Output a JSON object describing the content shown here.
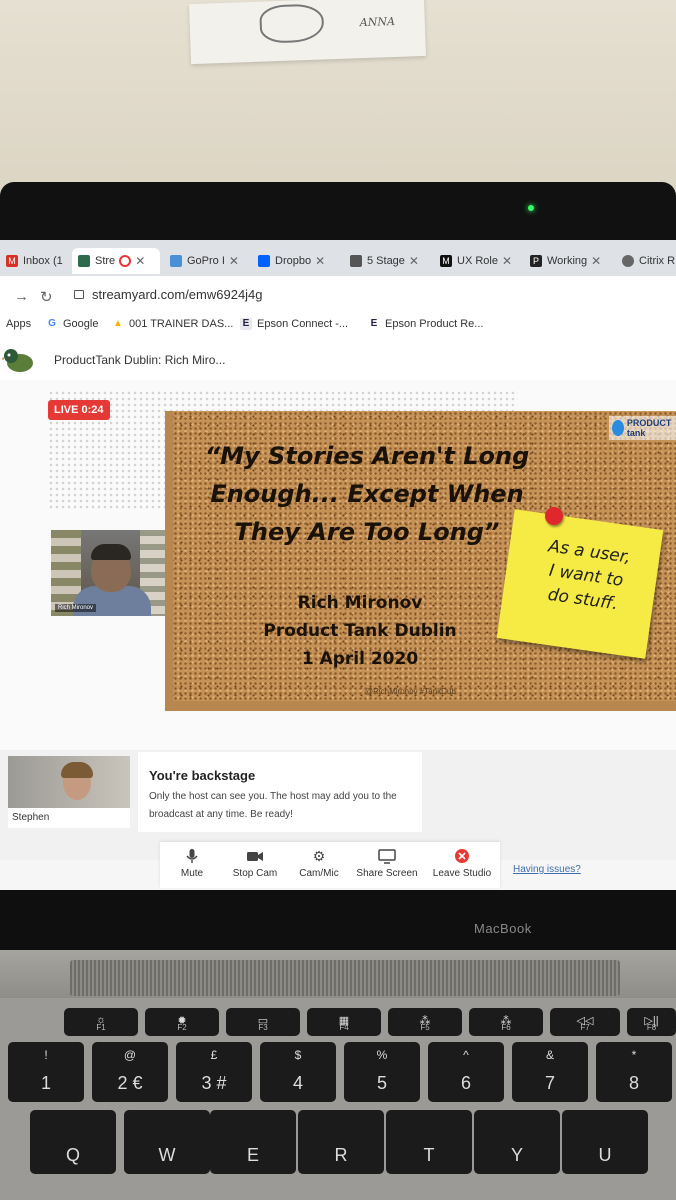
{
  "wall_note": {
    "text": "ANNA"
  },
  "browser": {
    "tabs": [
      {
        "label": "Inbox (1",
        "icon": "mail-icon",
        "color": "#d93025",
        "close": "✕"
      },
      {
        "label": "Stre",
        "icon": "streamyard-icon",
        "color": "#2d6b4e",
        "close": "✕",
        "recording": true
      },
      {
        "label": "GoPro I",
        "icon": "gopro-icon",
        "color": "#4a90d9",
        "close": "✕"
      },
      {
        "label": "Dropbo",
        "icon": "dropbox-icon",
        "color": "#0061fe",
        "close": "✕"
      },
      {
        "label": "5 Stage",
        "icon": "tree-icon",
        "color": "#555555",
        "close": "✕"
      },
      {
        "label": "UX Role",
        "icon": "medium-icon",
        "color": "#111111",
        "close": "✕"
      },
      {
        "label": "Working",
        "icon": "p-icon",
        "color": "#222222",
        "close": "✕"
      },
      {
        "label": "Citrix R",
        "icon": "citrix-icon",
        "color": "#666666",
        "close": ""
      }
    ],
    "url": "streamyard.com/emw6924j4g",
    "bookmarks": [
      {
        "label": "Apps",
        "icon": "apps-icon"
      },
      {
        "label": "Google",
        "icon": "google-icon"
      },
      {
        "label": "001 TRAINER DAS...",
        "icon": "drive-icon"
      },
      {
        "label": "Epson Connect -...",
        "icon": "epson-icon"
      },
      {
        "label": "Epson Product Re...",
        "icon": "epson-icon"
      }
    ]
  },
  "app": {
    "stream_title": "ProductTank Dublin: Rich Miro...",
    "live_badge": "LIVE 0:24",
    "speaker_name": "Rich Mironov",
    "slide": {
      "title_lines": [
        "“My Stories Aren't Long",
        "Enough... Except When",
        "They Are Too Long”"
      ],
      "author_lines": [
        "Rich Mironov",
        "Product Tank Dublin",
        "1 April 2020"
      ],
      "postit_lines": [
        "As a user,",
        "I want to",
        "do stuff."
      ],
      "brand": "PRODUCT tank",
      "credit": "@RichMironov #TankDub"
    },
    "backstage": {
      "self_name": "Stephen",
      "title": "You're backstage",
      "text": "Only the host can see you. The host may add you to the broadcast at any time. Be ready!"
    },
    "controls": [
      {
        "label": "Mute",
        "icon": "microphone-icon"
      },
      {
        "label": "Stop Cam",
        "icon": "camera-icon"
      },
      {
        "label": "Cam/Mic",
        "icon": "gear-icon"
      },
      {
        "label": "Share Screen",
        "icon": "monitor-icon"
      },
      {
        "label": "Leave Studio",
        "icon": "leave-icon"
      }
    ],
    "help_link": "Having issues?"
  },
  "device": {
    "brand": "MacBook"
  },
  "keyboard": {
    "fn_row": [
      "F1",
      "F2",
      "F3",
      "F4",
      "F5",
      "F6",
      "F7",
      "F8"
    ],
    "number_row": [
      {
        "top": "!",
        "main": "1"
      },
      {
        "top": "@",
        "main": "2 €"
      },
      {
        "top": "£",
        "main": "3 #"
      },
      {
        "top": "$",
        "main": "4"
      },
      {
        "top": "%",
        "main": "5"
      },
      {
        "top": "^",
        "main": "6"
      },
      {
        "top": "&",
        "main": "7"
      },
      {
        "top": "*",
        "main": "8"
      }
    ],
    "letter_row": [
      "Q",
      "W",
      "E",
      "R",
      "T",
      "Y",
      "U"
    ]
  }
}
